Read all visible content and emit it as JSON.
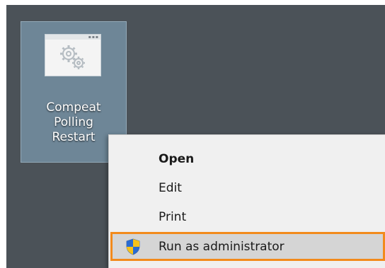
{
  "desktop_icon": {
    "label_lines": [
      "Compeat",
      "Polling",
      "Restart"
    ],
    "thumbnail_icon": "gears-icon"
  },
  "context_menu": {
    "items": [
      {
        "label": "Open",
        "default": true
      },
      {
        "label": "Edit"
      },
      {
        "label": "Print"
      },
      {
        "label": "Run as administrator",
        "icon": "uac-shield-icon",
        "highlighted": true
      }
    ]
  },
  "colors": {
    "desktop": "#4b5258",
    "icon_selected": "#6e8697",
    "menu_bg": "#f0f0f0",
    "highlight_outline": "#f28a1c"
  }
}
